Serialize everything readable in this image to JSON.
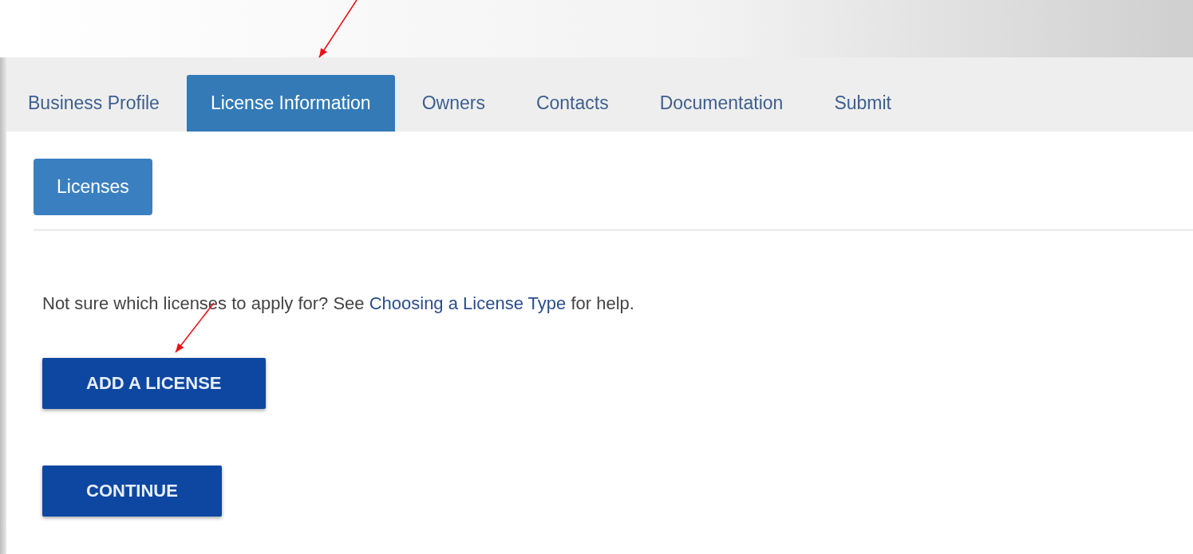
{
  "tabs": [
    {
      "label": "Business Profile",
      "selected": false
    },
    {
      "label": "License Information",
      "selected": true
    },
    {
      "label": "Owners",
      "selected": false
    },
    {
      "label": "Contacts",
      "selected": false
    },
    {
      "label": "Documentation",
      "selected": false
    },
    {
      "label": "Submit",
      "selected": false
    }
  ],
  "subtabs": [
    {
      "label": "Licenses",
      "selected": true
    }
  ],
  "help_text": {
    "before": "Not sure which licenses to apply for? See ",
    "link": "Choosing a License Type",
    "after": " for help."
  },
  "buttons": [
    "ADD A LICENSE",
    "CONTINUE"
  ],
  "annotations": [
    {
      "kind": "arrow"
    },
    {
      "kind": "arrow"
    }
  ]
}
